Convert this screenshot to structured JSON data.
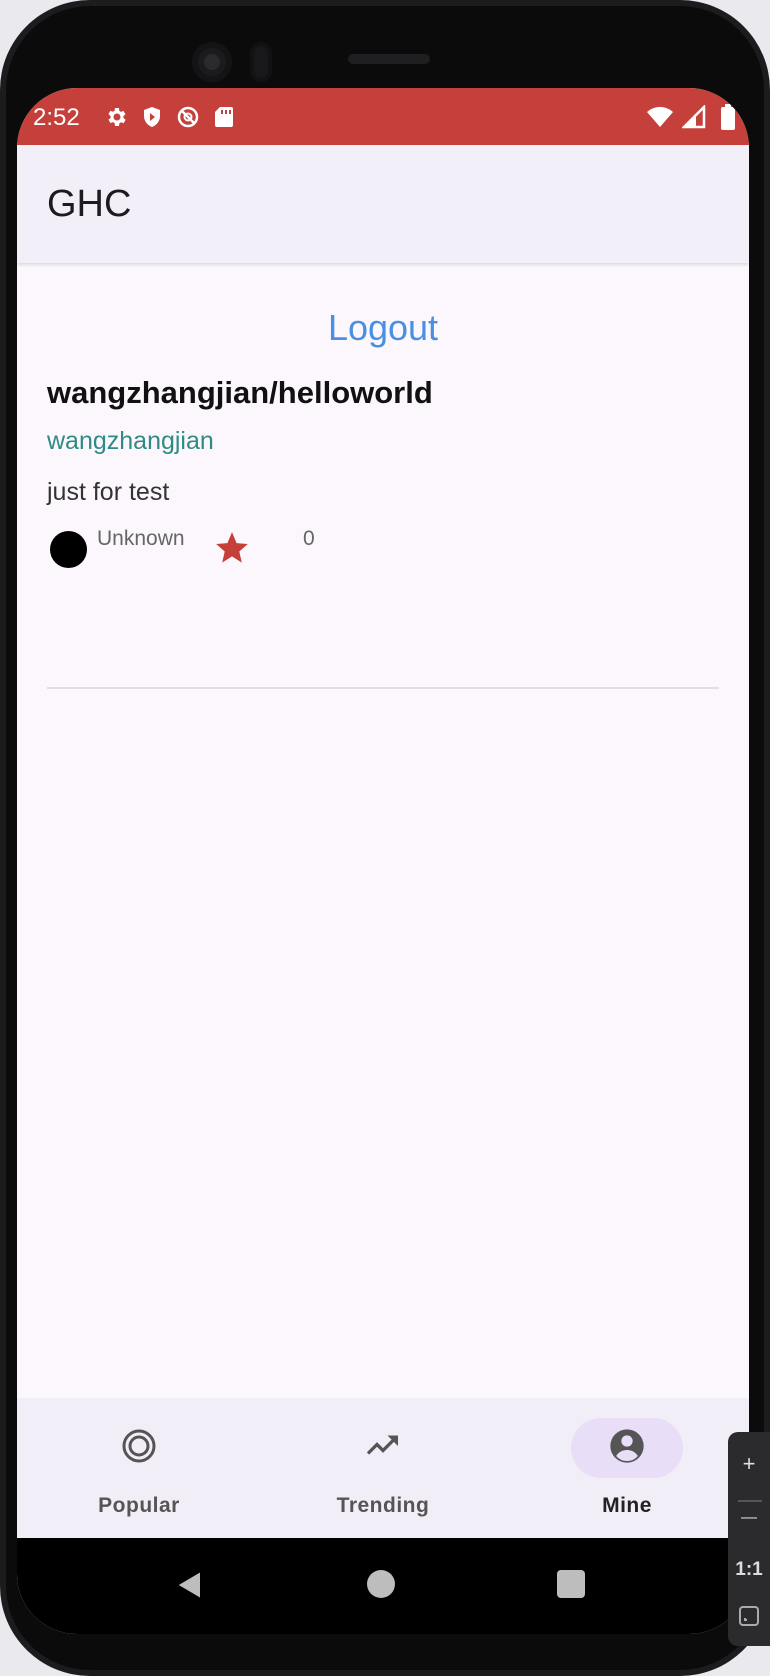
{
  "statusbar": {
    "time": "2:52",
    "left_icons": [
      "settings-icon",
      "shield-play-icon",
      "no-location-icon",
      "sd-card-icon"
    ],
    "right_icons": [
      "wifi-icon",
      "signal-icon",
      "battery-icon"
    ],
    "color": "#c5403a"
  },
  "appbar": {
    "title": "GHC"
  },
  "main": {
    "logout_label": "Logout",
    "repo": {
      "full_name": "wangzhangjian/helloworld",
      "owner": "wangzhangjian",
      "description": "just for test",
      "language": "Unknown",
      "stars": "0"
    }
  },
  "bottom_nav": {
    "items": [
      {
        "label": "Popular",
        "icon": "target-icon"
      },
      {
        "label": "Trending",
        "icon": "trending-up-icon"
      },
      {
        "label": "Mine",
        "icon": "account-circle-icon"
      }
    ],
    "active": "Mine"
  },
  "side_panel": {
    "zoom_in": "+",
    "zoom_out": "—",
    "ratio": "1:1"
  }
}
